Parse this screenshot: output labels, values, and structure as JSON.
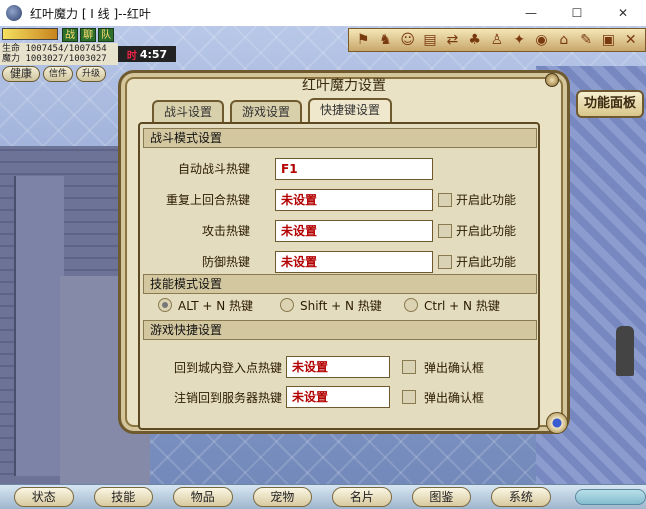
{
  "window": {
    "title": "红叶魔力  [ I 线 ]--红叶",
    "controls": [
      "—",
      "☐",
      "✕"
    ]
  },
  "hud": {
    "buttons": [
      "战",
      "聊",
      "队"
    ],
    "hp_label": "生命",
    "hp_value": "1007454/1007454",
    "mp_label": "魔力",
    "mp_value": "1003027/1003027",
    "time_label": "时",
    "time": "4:57",
    "health_badge": "健康",
    "mail": "信件",
    "upgrade": "升级"
  },
  "action_bar": {
    "icons": [
      "flag-icon",
      "dance-icon",
      "people-icon",
      "card-icon",
      "trade-icon",
      "group-icon",
      "pose-icon",
      "sit-icon",
      "eye-icon",
      "house-icon",
      "sign-icon",
      "book-icon",
      "tools-icon"
    ]
  },
  "dialog": {
    "title": "红叶魔力设置",
    "func_panel": "功能面板",
    "tabs": [
      {
        "label": "战斗设置",
        "active": false
      },
      {
        "label": "游戏设置",
        "active": false
      },
      {
        "label": "快捷键设置",
        "active": true
      }
    ],
    "battle_section": {
      "title": "战斗模式设置",
      "rows": [
        {
          "label": "自动战斗热键",
          "value": "F1",
          "has_checkbox": false
        },
        {
          "label": "重复上回合热键",
          "value": "未设置",
          "has_checkbox": true,
          "checkbox_label": "开启此功能"
        },
        {
          "label": "攻击热键",
          "value": "未设置",
          "has_checkbox": true,
          "checkbox_label": "开启此功能"
        },
        {
          "label": "防御热键",
          "value": "未设置",
          "has_checkbox": true,
          "checkbox_label": "开启此功能"
        }
      ]
    },
    "skill_section": {
      "title": "技能模式设置",
      "options": [
        {
          "label": "ALT + N 热键",
          "selected": true
        },
        {
          "label": "Shift + N 热键",
          "selected": false
        },
        {
          "label": "Ctrl + N 热键",
          "selected": false
        }
      ]
    },
    "game_section": {
      "title": "游戏快捷设置",
      "rows": [
        {
          "label": "回到城内登入点热键",
          "value": "未设置",
          "checkbox_label": "弹出确认框"
        },
        {
          "label": "注销回到服务器热键",
          "value": "未设置",
          "checkbox_label": "弹出确认框"
        }
      ]
    }
  },
  "bottom_bar": {
    "buttons": [
      "状态",
      "技能",
      "物品",
      "宠物",
      "名片",
      "图鉴",
      "系统"
    ]
  }
}
